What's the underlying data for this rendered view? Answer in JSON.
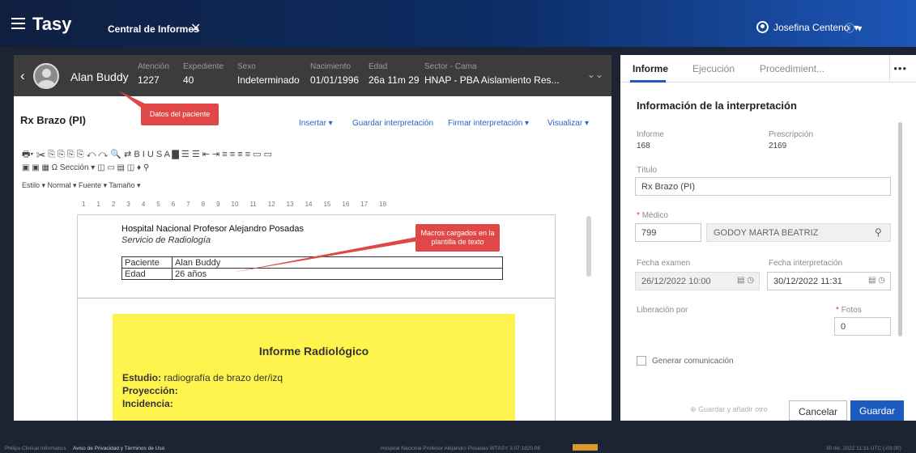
{
  "topbar": {
    "app_title": "Tasy",
    "tab_label": "Central de Informes",
    "tab_close": "✕",
    "user_name": "Josefina Centeno",
    "user_caret": "▾",
    "info_icon": "ⓘ",
    "info_caret": "▾"
  },
  "patient": {
    "back": "‹",
    "name": "Alan Buddy",
    "fields": [
      {
        "label": "Atención",
        "value": "1227"
      },
      {
        "label": "Expediente",
        "value": "40"
      },
      {
        "label": "Sexo",
        "value": "Indeterminado"
      },
      {
        "label": "Nacimiento",
        "value": "01/01/1996"
      },
      {
        "label": "Edad",
        "value": "26a 11m 29"
      },
      {
        "label": "Sector - Cama",
        "value": "HNAP - PBA Aislamiento Res..."
      }
    ],
    "expand": "⌄⌄"
  },
  "document": {
    "title": "Rx Brazo (PI)",
    "actions": [
      "Insertar ▾",
      "Guardar interpretación",
      "Firmar interpretación ▾",
      "Visualizar ▾"
    ],
    "toolbar_row1": "🖶▾  ✂  ⎘  ⎘  ⎘  ⎘  ↶  ↷  🔍  ⇄  B  I  U  S  A  ▇  ☰  ☰  ⇤  ⇥  ≡  ≡  ≡  ≡  ▭  ▭",
    "toolbar_row2": "▣  ▣  ▦  Ω  Sección  ▾  ◫  ▭  ▤  ◫  ♦  ⚲",
    "toolbar_row3": "Estilo       ▾  Normal      ▾  Fuente      ▾  Tamaño      ▾",
    "ruler": [
      "1",
      "1",
      "2",
      "3",
      "4",
      "5",
      "6",
      "7",
      "8",
      "9",
      "10",
      "11",
      "12",
      "13",
      "14",
      "15",
      "16",
      "17",
      "18"
    ],
    "hospital": "Hospital Nacional Profesor Alejandro Posadas",
    "service": "Servicio de Radiología",
    "macro_rows": [
      [
        "Paciente",
        "Alan Buddy"
      ],
      [
        "Edad",
        "26 años"
      ]
    ],
    "report_title": "Informe Radiológico",
    "lines": [
      {
        "label": "Estudio:",
        "value": " radiografía de brazo der/izq"
      },
      {
        "label": "Proyección:",
        "value": ""
      },
      {
        "label": "Incidencia:",
        "value": ""
      }
    ]
  },
  "annotations": {
    "patient_callout": "Datos del paciente",
    "macros_callout": "Macros cargados en la plantilla de texto"
  },
  "right": {
    "tabs": [
      "Informe",
      "Ejecución",
      "Procedimient..."
    ],
    "more": "•••",
    "heading": "Información de la interpretación",
    "informe_label": "Informe",
    "informe_value": "168",
    "prescripcion_label": "Prescripción",
    "prescripcion_value": "2169",
    "titulo_label": "Título",
    "titulo_value": "Rx Brazo (PI)",
    "medico_label": "Médico",
    "medico_code": "799",
    "medico_name": "GODOY MARTA BEATRIZ",
    "fecha_examen_label": "Fecha examen",
    "fecha_examen_value": "26/12/2022 10:00",
    "fecha_interp_label": "Fecha interpretación",
    "fecha_interp_value": "30/12/2022 11:31",
    "liberacion_label": "Liberación por",
    "fotos_label": "Fotos",
    "fotos_value": "0",
    "generar_label": "Generar comunicación",
    "guardar_otro": "Guardar y añadir otro",
    "cancelar": "Cancelar",
    "guardar": "Guardar"
  },
  "footer": {
    "left": "Philips Clinical Informatics",
    "privacy": "Aviso de Privacidad y Términos de Uso",
    "center": "Hospital Nacional Profesor Alejandro Posadas    WTASY 3.07.1820.06",
    "right": "30 dic. 2022  11:31  UTC (-03:00)"
  },
  "colors": {
    "accent": "#1e5bbf",
    "callout": "#e04848",
    "yellow": "#fff44e"
  }
}
